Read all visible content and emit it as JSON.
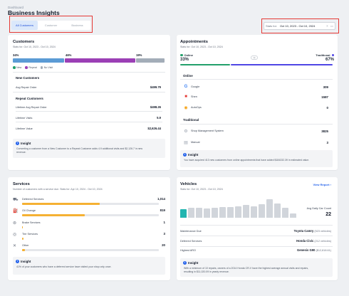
{
  "header": {
    "breadcrumb": "Dashboard",
    "title": "Business Insights"
  },
  "tabs": [
    {
      "label": "All Customers"
    },
    {
      "label": "Customer"
    },
    {
      "label": "Business"
    }
  ],
  "date_filter": {
    "label": "Stats for:",
    "value": "Oct 10, 2023 - Oct 10, 2024"
  },
  "customers": {
    "title": "Customers",
    "subtitle": "Stats for: Oct 10, 2023 - Oct 10, 2024",
    "segments": [
      {
        "name": "New",
        "pct": "34%",
        "value": 34,
        "color": "#5b9bd5"
      },
      {
        "name": "Repeat",
        "pct": "46%",
        "value": 46,
        "color": "#9b3fb5"
      },
      {
        "name": "No Visit",
        "pct": "19%",
        "value": 19,
        "color": "#a3adb8"
      }
    ],
    "new_title": "New Customers",
    "new_rows": [
      {
        "label": "Avg Repair Order",
        "value": "$499.79"
      }
    ],
    "repeat_title": "Repeat Customers",
    "repeat_rows": [
      {
        "label": "Lifetime Avg Repair Order",
        "value": "$498.26"
      },
      {
        "label": "Lifetime Visits",
        "value": "5.9"
      },
      {
        "label": "Lifetime Value",
        "value": "$2,626.44"
      }
    ],
    "insight_title": "Insight",
    "insight_line1": "Converting a customer from a New Customer to a Repeat Customer adds 4.9 additional visits and $2,126.7 in new",
    "insight_line2": "revenue."
  },
  "appointments": {
    "title": "Appointments",
    "subtitle": "Stats for: Oct 10, 2023 - Oct 10, 2024",
    "online_label": "Online",
    "online_pct": "33%",
    "online_value": 33,
    "traditional_label": "Traditional",
    "traditional_pct": "67%",
    "traditional_value": 67,
    "vs": "vs",
    "online_title": "Online",
    "online_rows": [
      {
        "label": "Google",
        "value": "309"
      },
      {
        "label": "Shen",
        "value": "1587"
      },
      {
        "label": "AutoOps",
        "value": "0"
      }
    ],
    "traditional_title": "Traditional",
    "traditional_rows": [
      {
        "label": "Shop Management System",
        "value": "3825"
      },
      {
        "label": "Manual",
        "value": "3"
      }
    ],
    "insight_title": "Insight",
    "insight_line1": "You have acquired 413 new customers from online appointments that have added $184332.39 in estimated value."
  },
  "services": {
    "title": "Services",
    "subtitle": "Number of customers with a service due. Stats for: Apr 10, 2024 - Oct 10, 2024",
    "rows": [
      {
        "label": "Deferred Services",
        "value": "1,014",
        "fill": 0.57
      },
      {
        "label": "Oil Change",
        "value": "819",
        "fill": 0.46
      },
      {
        "label": "Brake Services",
        "value": "1",
        "fill": 0.005
      },
      {
        "label": "Tire Services",
        "value": "3",
        "fill": 0.01
      },
      {
        "label": "Other",
        "value": "20",
        "fill": 0.02
      }
    ],
    "insight_title": "Insight",
    "insight_line1": "41% of your customers who have a deferred service have visited your shop only once."
  },
  "vehicles": {
    "title": "Vehicles",
    "subtitle": "Stats for: Oct 10, 2023 - Oct 10, 2024",
    "view_report": "View Report",
    "avg_label": "Avg Daily Car Count",
    "avg_value": "22",
    "rows": [
      {
        "label": "Maintenance Due",
        "value": "Toyota Camry",
        "note": "(523 vehicles)"
      },
      {
        "label": "Deferred Services",
        "value": "Honda Civic",
        "note": "(212 vehicles)"
      },
      {
        "label": "Highest ARO",
        "value": "Genesis G90",
        "note": "($12,818.61)"
      }
    ],
    "insight_title": "Insight",
    "insight_line1": "With a minimum of 10 repairs, owners of a 2014 Honda CR-V have the highest average annual visits and repairs,",
    "insight_line2": "resulting in $11,020.09 in yearly revenue."
  },
  "colors": {
    "accent": "#2563eb",
    "online": "#22a06b",
    "traditional": "#4f46e5",
    "highlight_box": "#e53935"
  }
}
